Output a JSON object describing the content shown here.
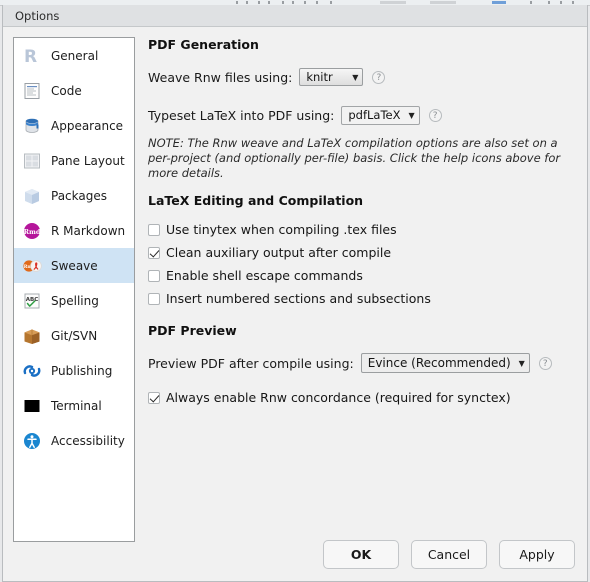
{
  "window": {
    "title": "Options"
  },
  "sidebar": {
    "items": [
      {
        "label": "General",
        "icon": "r-logo-icon",
        "selected": false
      },
      {
        "label": "Code",
        "icon": "document-icon",
        "selected": false
      },
      {
        "label": "Appearance",
        "icon": "paint-bucket-icon",
        "selected": false
      },
      {
        "label": "Pane Layout",
        "icon": "grid-panes-icon",
        "selected": false
      },
      {
        "label": "Packages",
        "icon": "box-cube-icon",
        "selected": false
      },
      {
        "label": "R Markdown",
        "icon": "rmd-badge-icon",
        "selected": false
      },
      {
        "label": "Sweave",
        "icon": "sweave-pdf-icon",
        "selected": true
      },
      {
        "label": "Spelling",
        "icon": "abc-check-icon",
        "selected": false
      },
      {
        "label": "Git/SVN",
        "icon": "cardboard-box-icon",
        "selected": false
      },
      {
        "label": "Publishing",
        "icon": "publish-icon",
        "selected": false
      },
      {
        "label": "Terminal",
        "icon": "terminal-icon",
        "selected": false
      },
      {
        "label": "Accessibility",
        "icon": "accessibility-icon",
        "selected": false
      }
    ]
  },
  "main": {
    "pdf_generation": {
      "heading": "PDF Generation",
      "weave_label": "Weave Rnw files using:",
      "weave_value": "knitr",
      "typeset_label": "Typeset LaTeX into PDF using:",
      "typeset_value": "pdfLaTeX",
      "help_glyph": "?",
      "caret_glyph": "▼",
      "note": "NOTE: The Rnw weave and LaTeX compilation options are also set on a per-project (and optionally per-file) basis. Click the help icons above for more details."
    },
    "latex_editing": {
      "heading": "LaTeX Editing and Compilation",
      "checkboxes": [
        {
          "label": "Use tinytex when compiling .tex files",
          "checked": false
        },
        {
          "label": "Clean auxiliary output after compile",
          "checked": true
        },
        {
          "label": "Enable shell escape commands",
          "checked": false
        },
        {
          "label": "Insert numbered sections and subsections",
          "checked": false
        }
      ]
    },
    "pdf_preview": {
      "heading": "PDF Preview",
      "preview_label": "Preview PDF after compile using:",
      "preview_value": "Evince (Recommended)",
      "concordance": {
        "label": "Always enable Rnw concordance (required for synctex)",
        "checked": true
      }
    }
  },
  "footer": {
    "ok": "OK",
    "cancel": "Cancel",
    "apply": "Apply"
  },
  "colors": {
    "selection": "#cfe3f4",
    "dialog_bg": "#f1f1f1",
    "titlebar_bg": "#dfe1e3"
  }
}
